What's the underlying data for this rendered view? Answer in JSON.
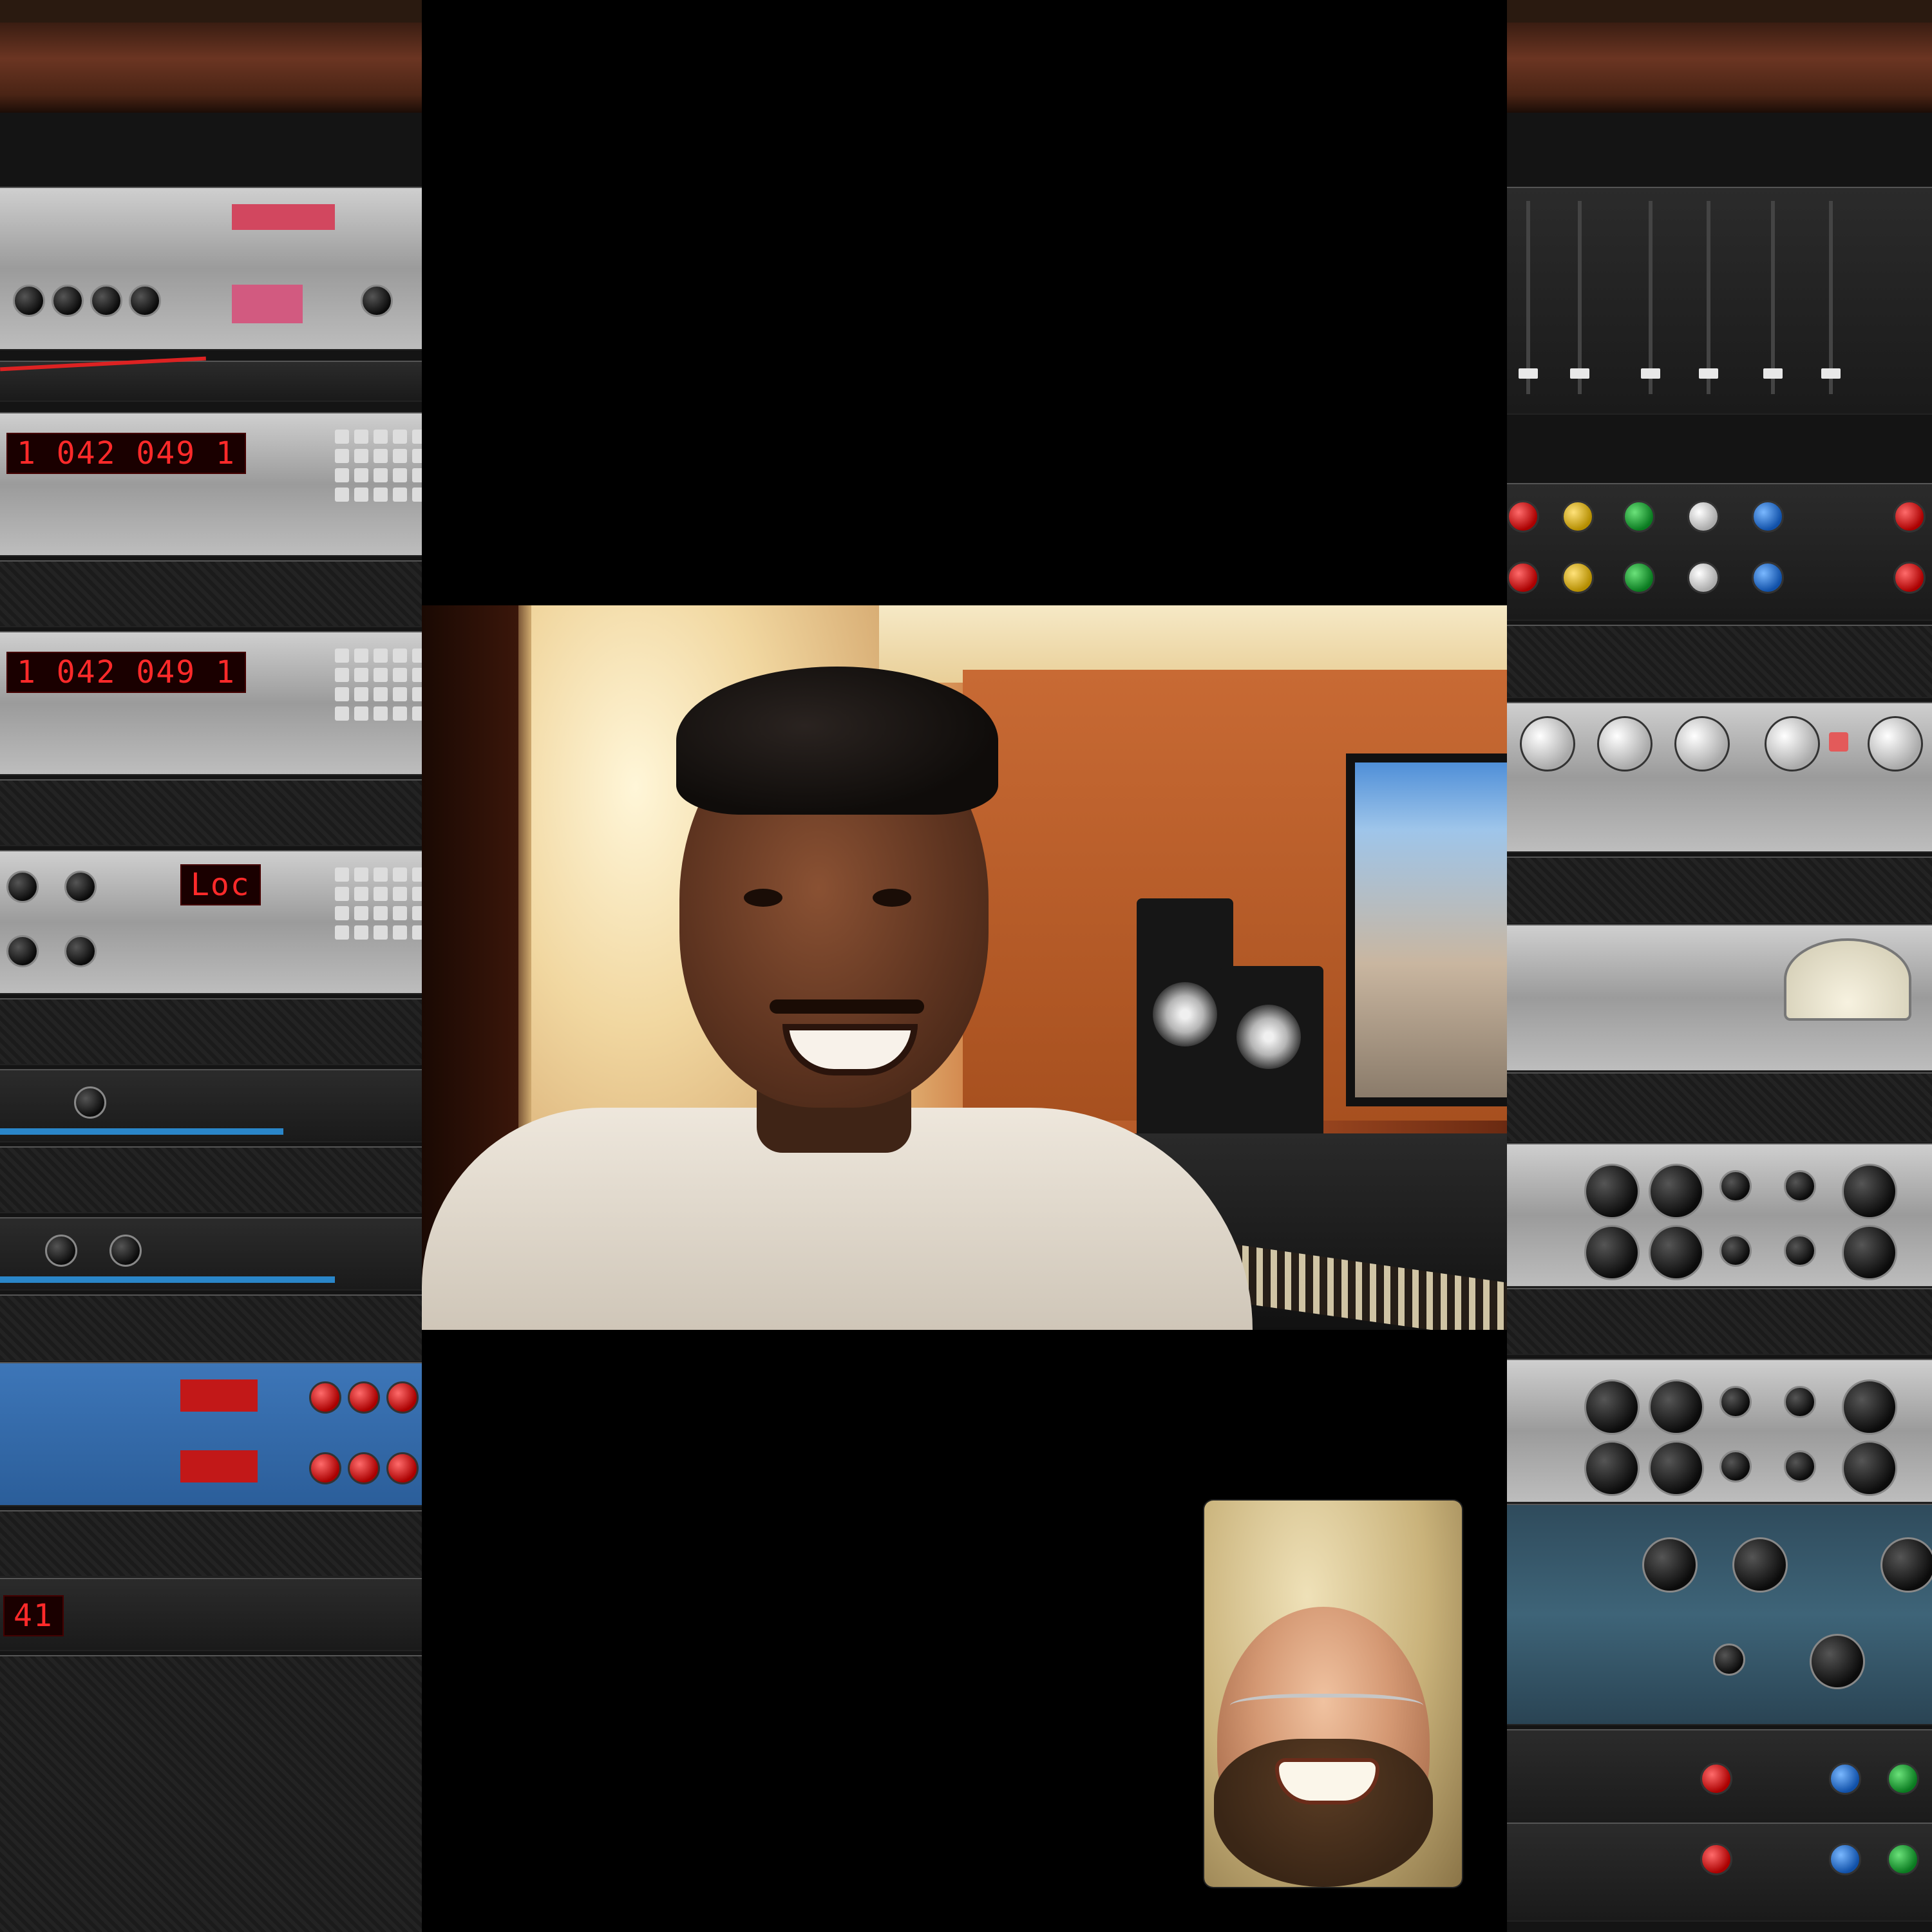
{
  "call": {
    "remote_participant_video": "remote-camera-feed",
    "self_preview_video": "self-camera-feed"
  },
  "left_rack": {
    "displays": [
      "1 042 049 1",
      "1 042 049 1",
      "Loc",
      "41"
    ]
  },
  "colors": {
    "background": "#000000",
    "shelf_wood": "#6b3522",
    "led_red": "#ff2a2a",
    "rack_blue": "#2b5e9a"
  }
}
